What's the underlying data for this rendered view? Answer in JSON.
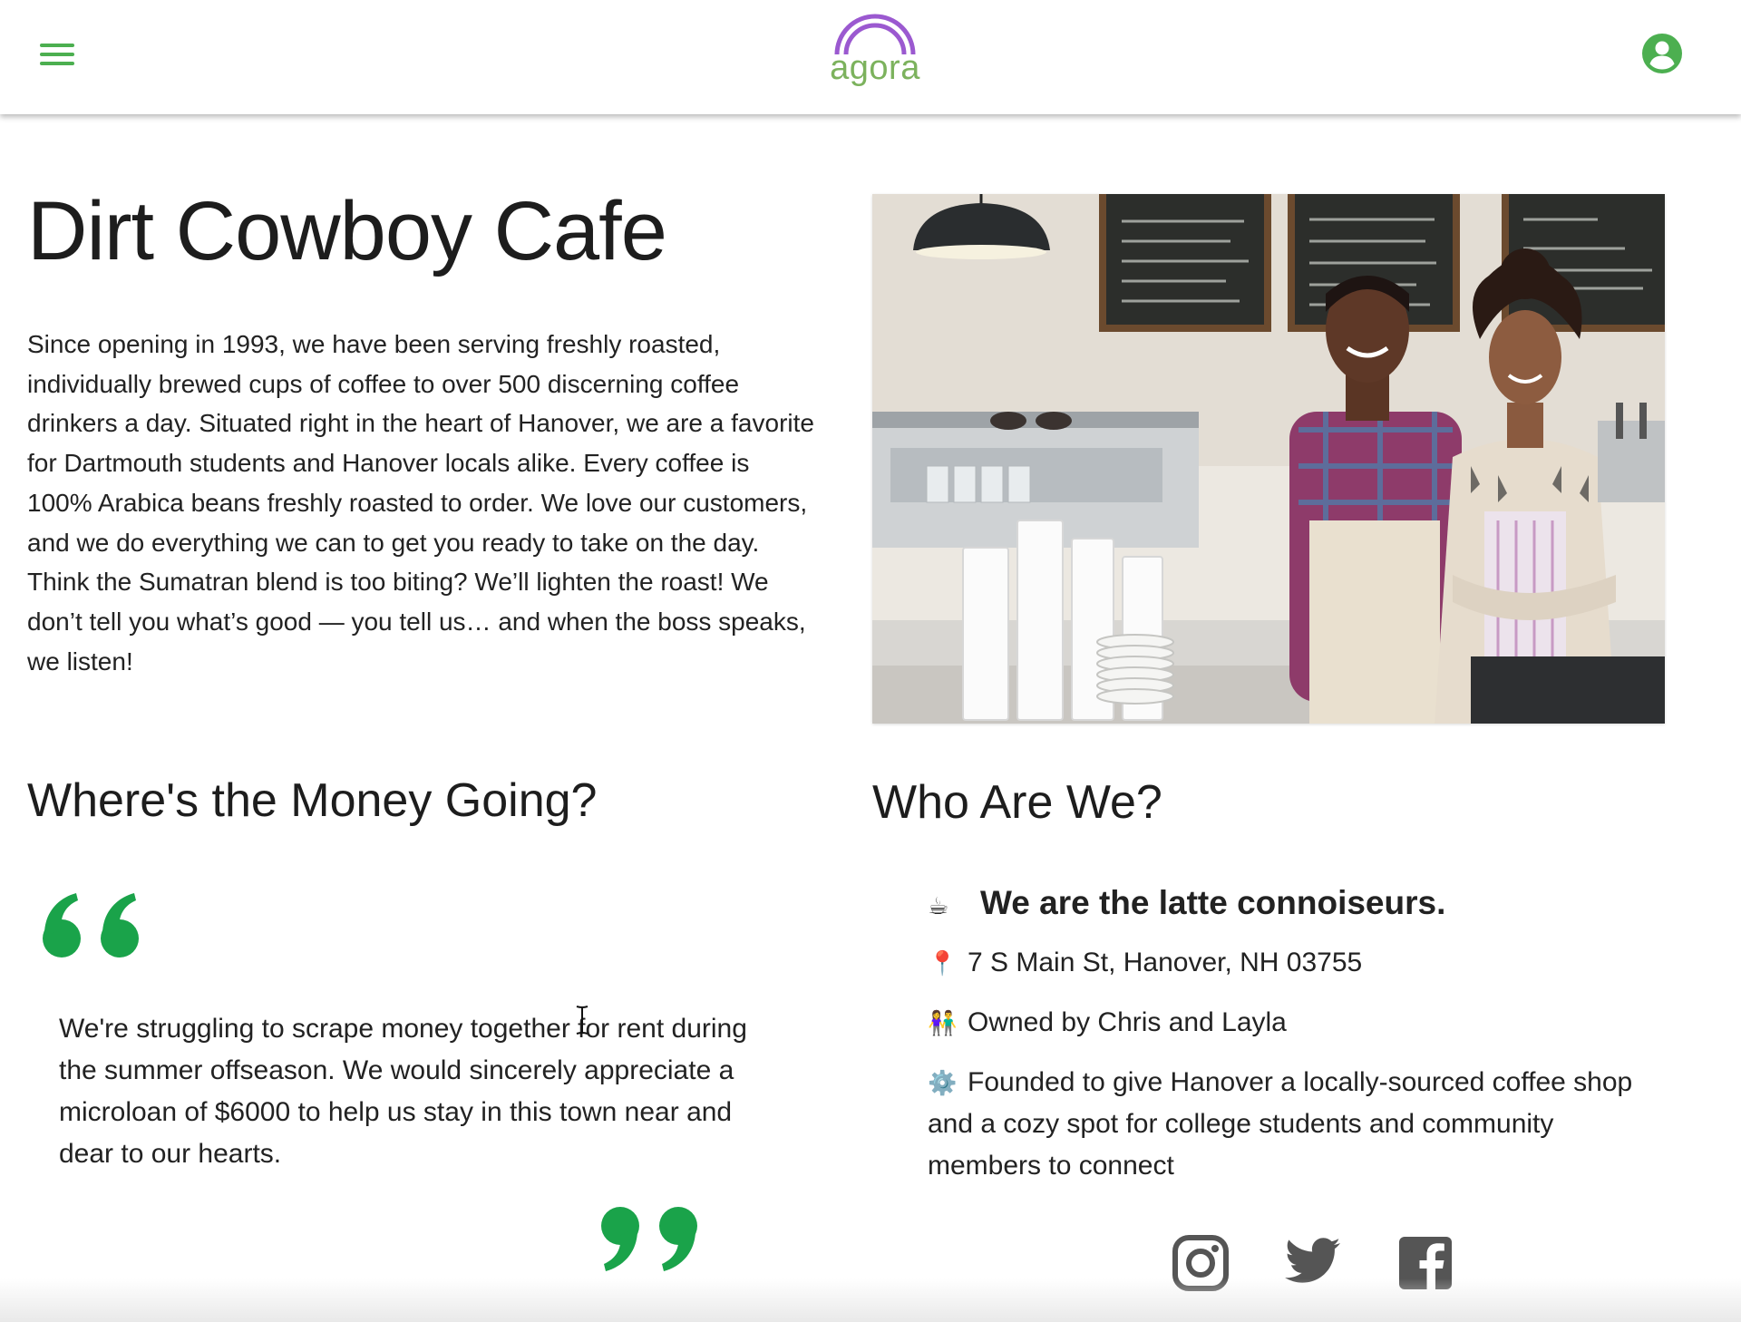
{
  "header": {
    "logo_text": "agora",
    "brand_color": "#4caf50",
    "logo_arc_color": "#9b59d0",
    "logo_text_color": "#7cb25d"
  },
  "business": {
    "name": "Dirt Cowboy Cafe",
    "description": "Since opening in 1993, we have been serving freshly roasted, individually brewed cups of coffee to over 500 discerning coffee drinkers a day. Situated right in the heart of Hanover, we are a favorite for Dartmouth students and Hanover locals alike. Every coffee is 100% Arabica beans freshly roasted to order. We love our customers, and we do everything we can to get you ready to take on the day. Think the Sumatran blend is too biting? We’ll lighten the roast! We don’t tell you what’s good — you tell us… and when the boss speaks, we listen!"
  },
  "money": {
    "heading": "Where's the Money Going?",
    "quote": "We're struggling to scrape money together for rent during the summer offseason. We would sincerely appreciate a microloan of $6000 to help us stay in this town near and dear to our hearts.",
    "quote_color": "#1aa34a"
  },
  "about": {
    "heading": "Who Are We?",
    "tagline": "We are the latte connoiseurs.",
    "tagline_icon": "☕",
    "address": "7 S Main St, Hanover, NH 03755",
    "address_icon": "📍",
    "owners": "Owned by Chris and Layla",
    "owners_icon": "👫",
    "founding": "Founded to give Hanover a locally-sourced coffee shop and a cozy spot for college students and community members to connect",
    "founding_icon": "⚙️"
  },
  "socials": [
    "instagram-icon",
    "twitter-icon",
    "facebook-icon"
  ]
}
